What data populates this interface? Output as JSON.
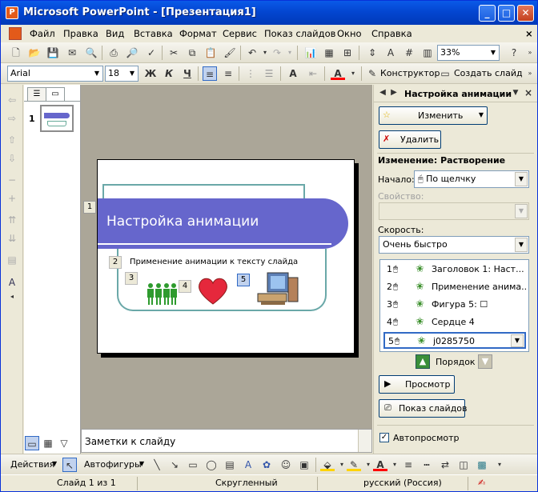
{
  "window": {
    "title": "Microsoft PowerPoint - [Презентация1]",
    "app_icon": "powerpoint-icon"
  },
  "menu": [
    "Файл",
    "Правка",
    "Вид",
    "Вставка",
    "Формат",
    "Сервис",
    "Показ слайдов",
    "Окно",
    "Справка"
  ],
  "standard_toolbar": {
    "zoom": "33%"
  },
  "format_toolbar": {
    "font": "Arial",
    "size": "18",
    "bold": "Ж",
    "italic": "К",
    "underline": "Ч",
    "designer": "Конструктор",
    "new_slide": "Создать слайд",
    "font_color": "#ff0000"
  },
  "thumbnails": {
    "slide_number": "1"
  },
  "slide": {
    "title": "Настройка анимации",
    "subtitle": "Применение анимации к тексту слайда",
    "tags": [
      "1",
      "2",
      "3",
      "4",
      "5"
    ],
    "title_color": "#6666cc"
  },
  "notes": {
    "placeholder": "Заметки к слайду"
  },
  "taskpane": {
    "title": "Настройка анимации",
    "change_button": "Изменить",
    "delete_button": "Удалить",
    "section": "Изменение: Растворение",
    "start_label": "Начало:",
    "start_value": "По щелчку",
    "property_label": "Свойство:",
    "speed_label": "Скорость:",
    "speed_value": "Очень быстро",
    "items": [
      {
        "num": "1",
        "text": "Заголовок 1: Наст..."
      },
      {
        "num": "2",
        "text": "Применение анима..."
      },
      {
        "num": "3",
        "text": "Фигура 5: ☐"
      },
      {
        "num": "4",
        "text": "Сердце 4"
      },
      {
        "num": "5",
        "text": "j0285750"
      }
    ],
    "order_label": "Порядок",
    "preview_button": "Просмотр",
    "slideshow_button": "Показ слайдов",
    "autopreview_label": "Автопросмотр"
  },
  "drawing": {
    "actions": "Действия",
    "autoshapes": "Автофигуры"
  },
  "status": {
    "slide": "Слайд 1 из 1",
    "design": "Скругленный",
    "language": "русский (Россия)"
  }
}
